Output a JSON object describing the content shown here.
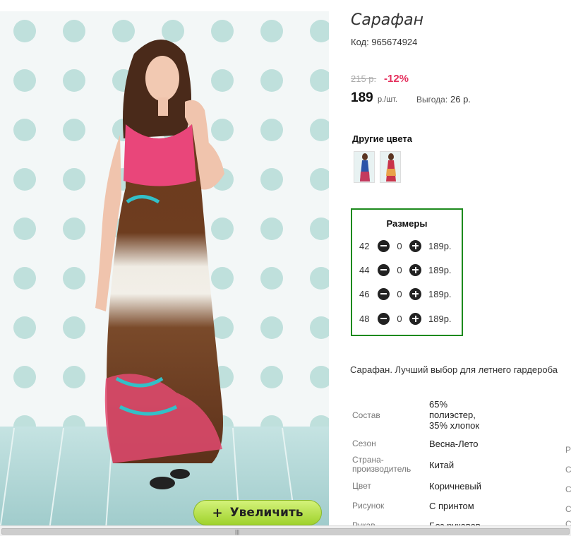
{
  "product": {
    "title": "Сарафан",
    "code": "Код: 965674924",
    "old_price": "215 р.",
    "discount": "-12%",
    "price": "189",
    "price_unit": "р./шт.",
    "benefit_label": "Выгода:",
    "benefit_value": "26 р.",
    "zoom_label": "Увеличить",
    "zoom_icon": "plus-icon",
    "description": "Сарафан. Лучший выбор для летнего гардероба"
  },
  "other_colors": {
    "title": "Другие цвета",
    "swatches": [
      {
        "color": "blue-dress"
      },
      {
        "color": "red-dress"
      }
    ]
  },
  "sizes": {
    "title": "Размеры",
    "rows": [
      {
        "size": "42",
        "qty": "0",
        "price": "189р."
      },
      {
        "size": "44",
        "qty": "0",
        "price": "189р."
      },
      {
        "size": "46",
        "qty": "0",
        "price": "189р."
      },
      {
        "size": "48",
        "qty": "0",
        "price": "189р."
      }
    ]
  },
  "specs": [
    {
      "label": "Состав",
      "value_lines": [
        "65%",
        "полиэстер,",
        "35% хлопок"
      ]
    },
    {
      "label": "Сезон",
      "value": "Весна-Лето"
    },
    {
      "label_lines": [
        "Страна-",
        "производитель"
      ],
      "value": "Китай"
    },
    {
      "label": "Цвет",
      "value": "Коричневый"
    },
    {
      "label": "Рисунок",
      "value": "С принтом"
    },
    {
      "label": "Рукав",
      "value": "Без рукавов"
    }
  ],
  "side_letters": [
    "Р",
    "С",
    "С",
    "С",
    "С"
  ],
  "colors": {
    "accent_green": "#1d8a1d",
    "discount_red": "#e5315e",
    "zoom_button": "#b5e04a"
  }
}
